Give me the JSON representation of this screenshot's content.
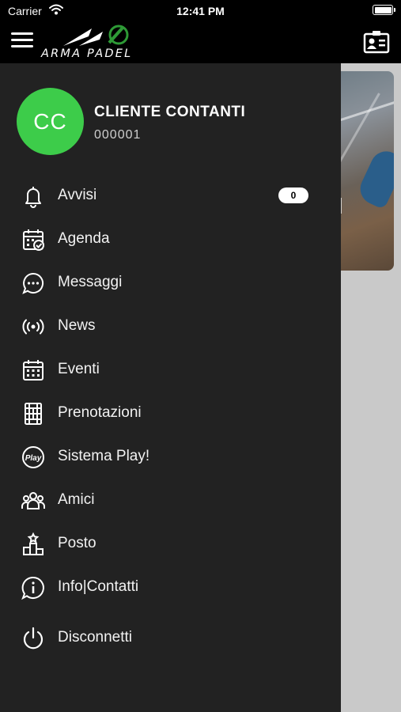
{
  "status_bar": {
    "carrier": "Carrier",
    "time": "12:41 PM"
  },
  "header": {
    "logo_text": "ARMA PADEL"
  },
  "user": {
    "initials": "CC",
    "name": "CLIENTE CONTANTI",
    "code": "000001"
  },
  "menu": [
    {
      "label": "Avvisi",
      "icon": "bell-icon",
      "badge": "0"
    },
    {
      "label": "Agenda",
      "icon": "calendar-check-icon"
    },
    {
      "label": "Messaggi",
      "icon": "chat-bubble-icon"
    },
    {
      "label": "News",
      "icon": "broadcast-icon"
    },
    {
      "label": "Eventi",
      "icon": "calendar-grid-icon"
    },
    {
      "label": "Prenotazioni",
      "icon": "court-icon"
    },
    {
      "label": "Sistema Play!",
      "icon": "play-badge-icon"
    },
    {
      "label": "Amici",
      "icon": "friends-icon"
    },
    {
      "label": "Posto",
      "icon": "podium-icon"
    },
    {
      "label": "Info|Contatti",
      "icon": "info-icon"
    },
    {
      "label": "Disconnetti",
      "icon": "power-icon"
    }
  ],
  "colors": {
    "accent": "#3dcc4a",
    "drawer_bg": "#222222",
    "topbar_bg": "#000000"
  }
}
